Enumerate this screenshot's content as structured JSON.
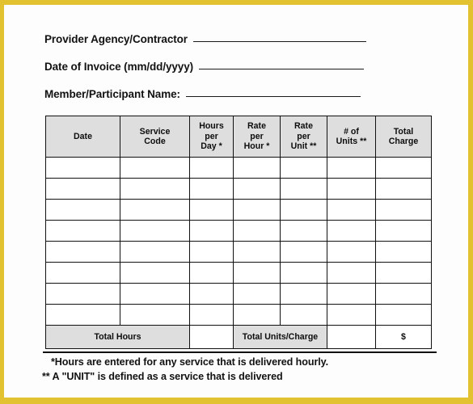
{
  "document": {
    "border_color": "#e2c230",
    "page_background": "#fdfdfd",
    "header_shade_color": "#dedede"
  },
  "fields": [
    {
      "label": "Provider Agency/Contractor",
      "value": ""
    },
    {
      "label": "Date of Invoice (mm/dd/yyyy)",
      "value": ""
    },
    {
      "label": "Member/Participant Name:",
      "value": ""
    }
  ],
  "table": {
    "columns": [
      "Date",
      "Service Code",
      "Hours per Day *",
      "Rate per Hour *",
      "Rate per Unit **",
      "# of Units **",
      "Total Charge"
    ],
    "columns_multiline": [
      [
        "Date"
      ],
      [
        "Service",
        "Code"
      ],
      [
        "Hours",
        "per",
        "Day *"
      ],
      [
        "Rate",
        "per",
        "Hour *"
      ],
      [
        "Rate",
        "per",
        "Unit **"
      ],
      [
        "# of",
        "Units **"
      ],
      [
        "Total",
        "Charge"
      ]
    ],
    "row_count": 8,
    "rows": [
      [
        "",
        "",
        "",
        "",
        "",
        "",
        ""
      ],
      [
        "",
        "",
        "",
        "",
        "",
        "",
        ""
      ],
      [
        "",
        "",
        "",
        "",
        "",
        "",
        ""
      ],
      [
        "",
        "",
        "",
        "",
        "",
        "",
        ""
      ],
      [
        "",
        "",
        "",
        "",
        "",
        "",
        ""
      ],
      [
        "",
        "",
        "",
        "",
        "",
        "",
        ""
      ],
      [
        "",
        "",
        "",
        "",
        "",
        "",
        ""
      ],
      [
        "",
        "",
        "",
        "",
        "",
        "",
        ""
      ]
    ],
    "totals": {
      "total_hours_label": "Total Hours",
      "total_hours_value": "",
      "total_units_charge_label": "Total Units/Charge",
      "total_units_value": "",
      "total_charge_value": "$"
    }
  },
  "footnotes": [
    "*Hours are entered for any service that is delivered hourly.",
    "** A \"UNIT\" is defined as a service that is delivered"
  ]
}
